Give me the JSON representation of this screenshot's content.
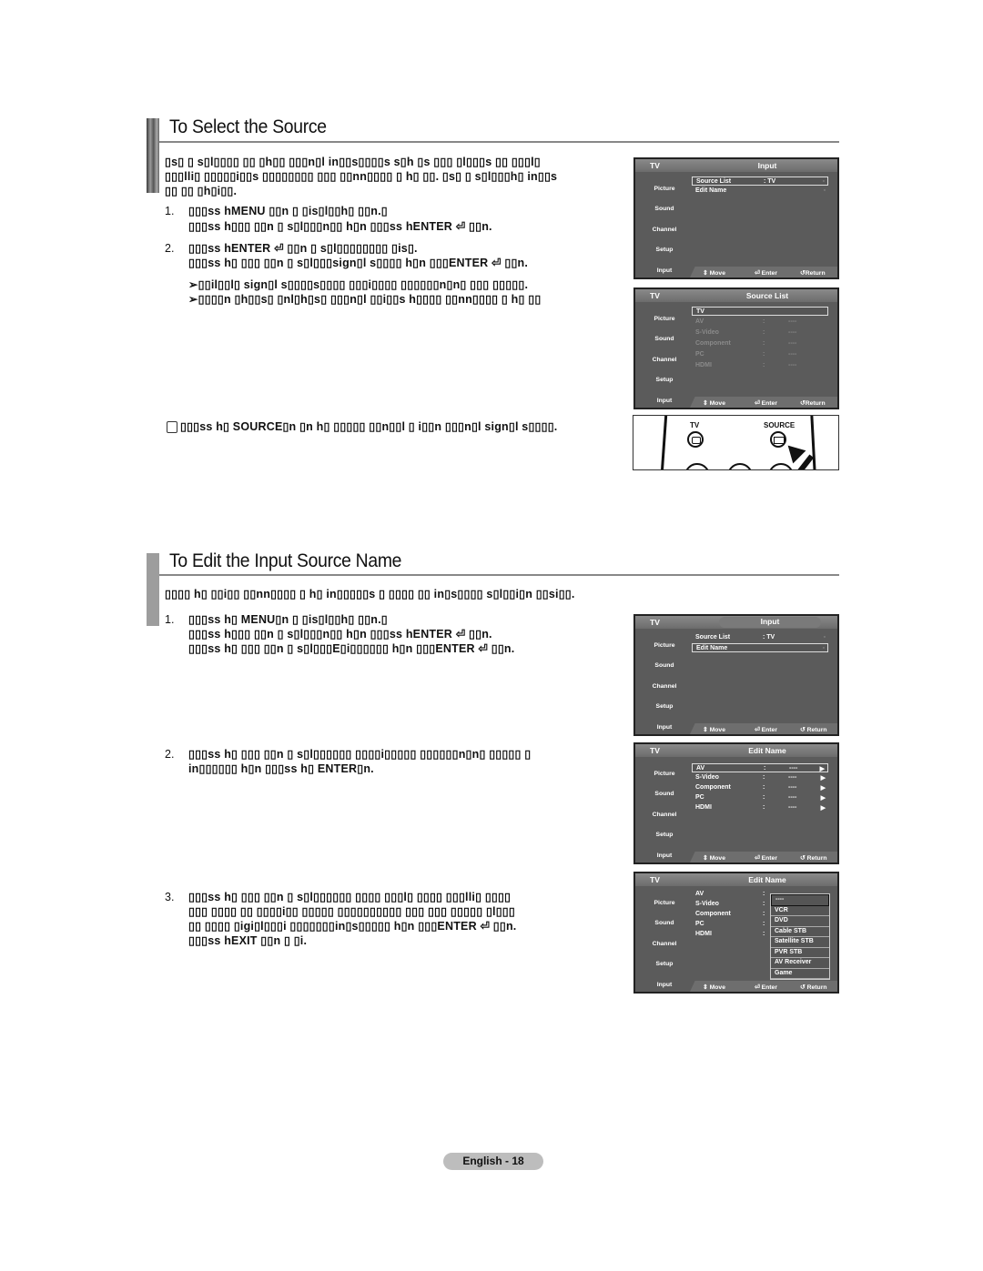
{
  "section1": {
    "title": "To Select the Source",
    "intro_lines": [
      "▯s▯ ▯ s▯l▯▯▯▯ ▯▯ ▯h▯▯ ▯▯▯n▯l in▯▯s▯▯▯▯s s▯h ▯s ▯▯▯ ▯l▯▯▯s ▯▯ ▯▯▯l▯",
      "▯▯▯lli▯ ▯▯▯▯▯i▯▯s ▯▯▯▯▯▯▯▯ ▯▯▯ ▯▯nn▯▯▯▯ ▯ h▯ ▯▯. ▯s▯ ▯ s▯l▯▯▯h▯ in▯▯s",
      "▯▯ ▯▯ ▯h▯i▯▯."
    ],
    "steps": [
      {
        "num": "1.",
        "lines": [
          "▯▯▯ss hMENU ▯▯n ▯ ▯is▯l▯▯h▯ ▯▯n.▯",
          "▯▯▯ss h▯▯▯ ▯▯n ▯ s▯l▯▯▯n▯▯ h▯n ▯▯▯ss hENTER ⏎ ▯▯n."
        ]
      },
      {
        "num": "2.",
        "lines": [
          "▯▯▯ss hENTER ⏎ ▯▯n ▯ s▯l▯▯▯▯▯▯▯▯ ▯is▯.",
          "▯▯▯ss h▯ ▯▯▯ ▯▯n ▯ s▯l▯▯▯sign▯l s▯▯▯▯ h▯n ▯▯▯ENTER ⏎ ▯▯n."
        ]
      }
    ],
    "notes": [
      "➢▯▯il▯▯l▯ sign▯l s▯▯▯▯s▯▯▯▯ ▯▯▯i▯▯▯▯ ▯▯▯▯▯▯n▯n▯ ▯▯▯ ▯▯▯▯▯.",
      "➢▯▯▯▯n ▯h▯▯s▯ ▯nl▯h▯s▯ ▯▯▯n▯l ▯▯i▯▯s h▯▯▯▯ ▯▯nn▯▯▯▯ ▯ h▯ ▯▯"
    ],
    "tip": "▯▯▯ss h▯ SOURCE▯n ▯n h▯ ▯▯▯▯▯ ▯▯n▯▯l ▯ i▯▯n ▯▯▯n▯l sign▯l s▯▯▯▯."
  },
  "section2": {
    "title": "To Edit the Input Source Name",
    "intro": "▯▯▯▯ h▯ ▯▯i▯▯ ▯▯nn▯▯▯▯ ▯ h▯ in▯▯▯▯▯s ▯ ▯▯▯▯ ▯▯ in▯s▯▯▯▯ s▯l▯▯i▯n ▯▯si▯▯.",
    "steps": [
      {
        "num": "1.",
        "lines": [
          "▯▯▯ss h▯ MENU▯n ▯ ▯is▯l▯▯h▯ ▯▯n.▯",
          "▯▯▯ss h▯▯▯ ▯▯n ▯ s▯l▯▯▯n▯▯ h▯n ▯▯▯ss hENTER ⏎ ▯▯n.",
          "▯▯▯ss h▯ ▯▯▯ ▯▯n ▯ s▯l▯▯▯E▯i▯▯▯▯▯▯ h▯n ▯▯▯ENTER ⏎ ▯▯n."
        ]
      },
      {
        "num": "2.",
        "lines": [
          "▯▯▯ss h▯ ▯▯▯ ▯▯n ▯ s▯l▯▯▯▯▯▯ ▯▯▯▯i▯▯▯▯▯ ▯▯▯▯▯▯n▯n▯ ▯▯▯▯▯ ▯",
          "in▯▯▯▯▯▯ h▯n ▯▯▯ss h▯ ENTER▯n."
        ]
      },
      {
        "num": "3.",
        "lines": [
          "▯▯▯ss h▯ ▯▯▯ ▯▯n ▯ s▯l▯▯▯▯▯▯ ▯▯▯▯ ▯▯▯l▯ ▯▯▯▯ ▯▯▯lli▯ ▯▯▯▯",
          "▯▯▯ ▯▯▯▯ ▯▯ ▯▯▯▯i▯▯ ▯▯▯▯▯ ▯▯▯▯▯▯▯▯▯▯ ▯▯▯ ▯▯▯ ▯▯▯▯▯ ▯l▯▯▯",
          "▯▯ ▯▯▯▯ ▯igi▯l▯▯▯i ▯▯▯▯▯▯▯in▯s▯▯▯▯▯ h▯n ▯▯▯ENTER ⏎ ▯▯n.",
          "▯▯▯ss hEXIT ▯▯n ▯ ▯i."
        ]
      }
    ]
  },
  "osd_common": {
    "tv_label": "TV",
    "side_menu": [
      "Picture",
      "Sound",
      "Channel",
      "Setup",
      "Input"
    ],
    "footer": {
      "move": "Move",
      "enter": "Enter",
      "return": "Return"
    }
  },
  "osd1": {
    "title": "Input",
    "rows": [
      {
        "label": "Source List",
        "value": ": TV",
        "selected": true
      },
      {
        "label": "Edit Name",
        "value": "",
        "selected": false
      }
    ]
  },
  "osd2": {
    "title": "Source List",
    "rows": [
      {
        "label": "TV",
        "colon": "",
        "value": "",
        "selected": true,
        "dim": false
      },
      {
        "label": "AV",
        "colon": ":",
        "value": "----",
        "dim": true
      },
      {
        "label": "S-Video",
        "colon": ":",
        "value": "----",
        "dim": true
      },
      {
        "label": "Component",
        "colon": ":",
        "value": "----",
        "dim": true
      },
      {
        "label": "PC",
        "colon": ":",
        "value": "----",
        "dim": true
      },
      {
        "label": "HDMI",
        "colon": ":",
        "value": "----",
        "dim": true
      }
    ]
  },
  "osd3": {
    "title": "Input",
    "rows": [
      {
        "label": "Source List",
        "value": ": TV",
        "selected": false
      },
      {
        "label": "Edit Name",
        "value": "",
        "selected": true
      }
    ]
  },
  "osd4": {
    "title": "Edit Name",
    "rows": [
      {
        "label": "AV",
        "colon": ":",
        "value": "----",
        "arrow": "▶",
        "selected": true
      },
      {
        "label": "S-Video",
        "colon": ":",
        "value": "----",
        "arrow": "▶"
      },
      {
        "label": "Component",
        "colon": ":",
        "value": "----",
        "arrow": "▶"
      },
      {
        "label": "PC",
        "colon": ":",
        "value": "----",
        "arrow": "▶"
      },
      {
        "label": "HDMI",
        "colon": ":",
        "value": "----",
        "arrow": "▶"
      }
    ]
  },
  "osd5": {
    "title": "Edit Name",
    "rows": [
      {
        "label": "AV",
        "colon": ":"
      },
      {
        "label": "S-Video",
        "colon": ":"
      },
      {
        "label": "Component",
        "colon": ":"
      },
      {
        "label": "PC",
        "colon": ":"
      },
      {
        "label": "HDMI",
        "colon": ":"
      }
    ],
    "dropdown": [
      "----",
      "VCR",
      "DVD",
      "Cable STB",
      "Satellite STB",
      "PVR STB",
      "AV Receiver",
      "Game"
    ]
  },
  "remote": {
    "tv_label": "TV",
    "source_label": "SOURCE"
  },
  "footer": {
    "page_label": "English - 18"
  }
}
